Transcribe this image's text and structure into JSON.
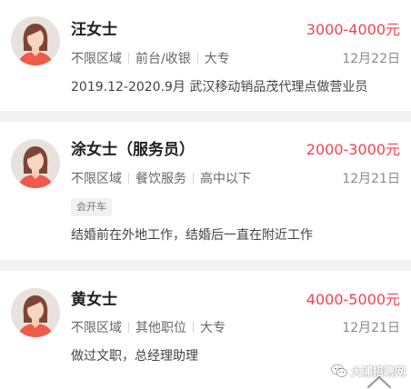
{
  "candidates": [
    {
      "name": "汪女士",
      "salary": "3000-4000元",
      "region": "不限区域",
      "position": "前台/收银",
      "education": "大专",
      "date": "12月22日",
      "description": "2019.12-2020.9月 武汉移动销品茂代理点做营业员"
    },
    {
      "name": "涂女士（服务员）",
      "salary": "2000-3000元",
      "region": "不限区域",
      "position": "餐饮服务",
      "education": "高中以下",
      "date": "12月21日",
      "tag": "会开车",
      "description": "结婚前在外地工作，结婚后一直在附近工作"
    },
    {
      "name": "黄女士",
      "salary": "4000-5000元",
      "region": "不限区域",
      "position": "其他职位",
      "education": "大专",
      "date": "12月21日",
      "description": "做过文职，总经理助理"
    }
  ],
  "watermark": {
    "text": "大浦招聘网",
    "icon": "wechat-icon"
  },
  "scroll_top_icon": "chevron-up-icon",
  "colors": {
    "salary": "#f2434f",
    "name": "#1f1f1f",
    "meta": "#666666",
    "date": "#8a8a8a",
    "background": "#f2f2f5",
    "card": "#ffffff"
  }
}
